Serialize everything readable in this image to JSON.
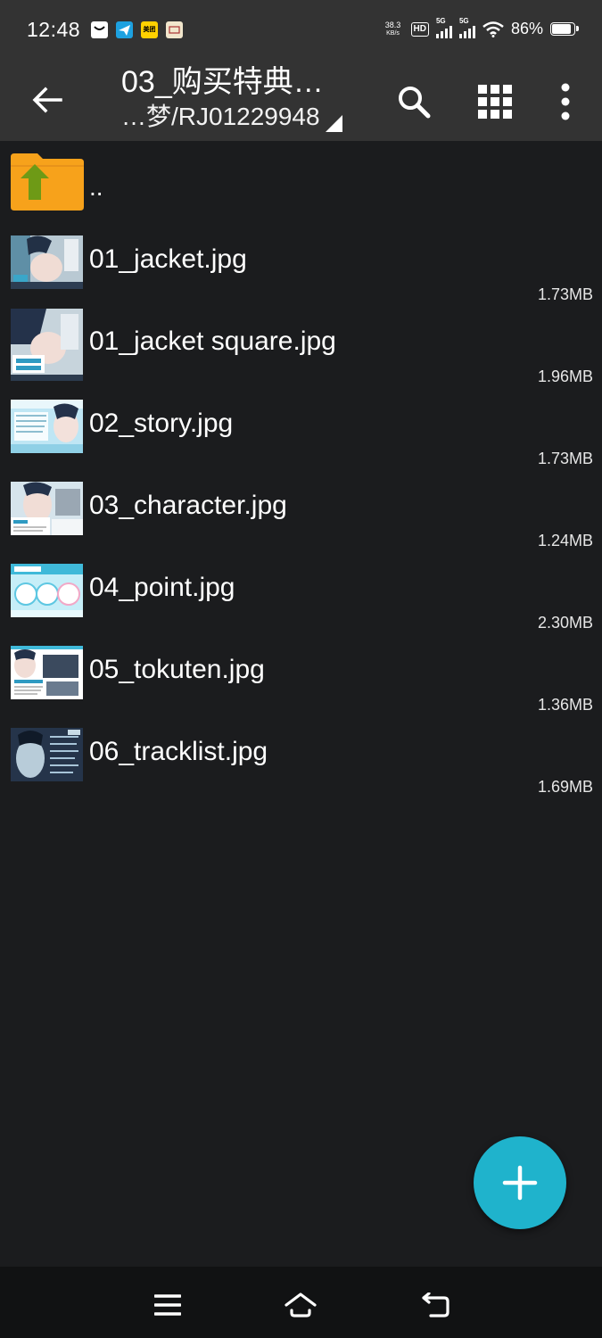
{
  "status_bar": {
    "time": "12:48",
    "notifications": [
      {
        "icon": "message-icon",
        "label": ""
      },
      {
        "icon": "paper-plane-icon",
        "label": ""
      },
      {
        "icon": "meituan-icon",
        "label": "美团"
      },
      {
        "icon": "card-icon",
        "label": ""
      }
    ],
    "net_speed_value": "38.3",
    "net_speed_unit": "KB/s",
    "hd_label": "HD",
    "signal_1": "5G",
    "signal_2": "5G",
    "battery_percent": "86%",
    "battery_level": 0.86
  },
  "app_bar": {
    "title": "03_购买特典…",
    "path": "…梦/RJ01229948",
    "icons": [
      "back-arrow-icon",
      "search-icon",
      "grid-view-icon",
      "more-vert-icon"
    ]
  },
  "parent_entry": {
    "label": ".."
  },
  "files": [
    {
      "name": "01_jacket.jpg",
      "size": "1.73MB"
    },
    {
      "name": "01_jacket square.jpg",
      "size": "1.96MB"
    },
    {
      "name": "02_story.jpg",
      "size": "1.73MB"
    },
    {
      "name": "03_character.jpg",
      "size": "1.24MB"
    },
    {
      "name": "04_point.jpg",
      "size": "2.30MB"
    },
    {
      "name": "05_tokuten.jpg",
      "size": "1.36MB"
    },
    {
      "name": "06_tracklist.jpg",
      "size": "1.69MB"
    }
  ],
  "fab_icon": "plus-icon",
  "nav_bar": {
    "icons": [
      "menu-icon",
      "home-icon",
      "back-icon"
    ]
  },
  "colors": {
    "background": "#1b1c1e",
    "toolbar": "#333333",
    "fab": "#1fb3cc",
    "folder": "#f7a21b",
    "folder_arrow": "#6e9a16"
  }
}
